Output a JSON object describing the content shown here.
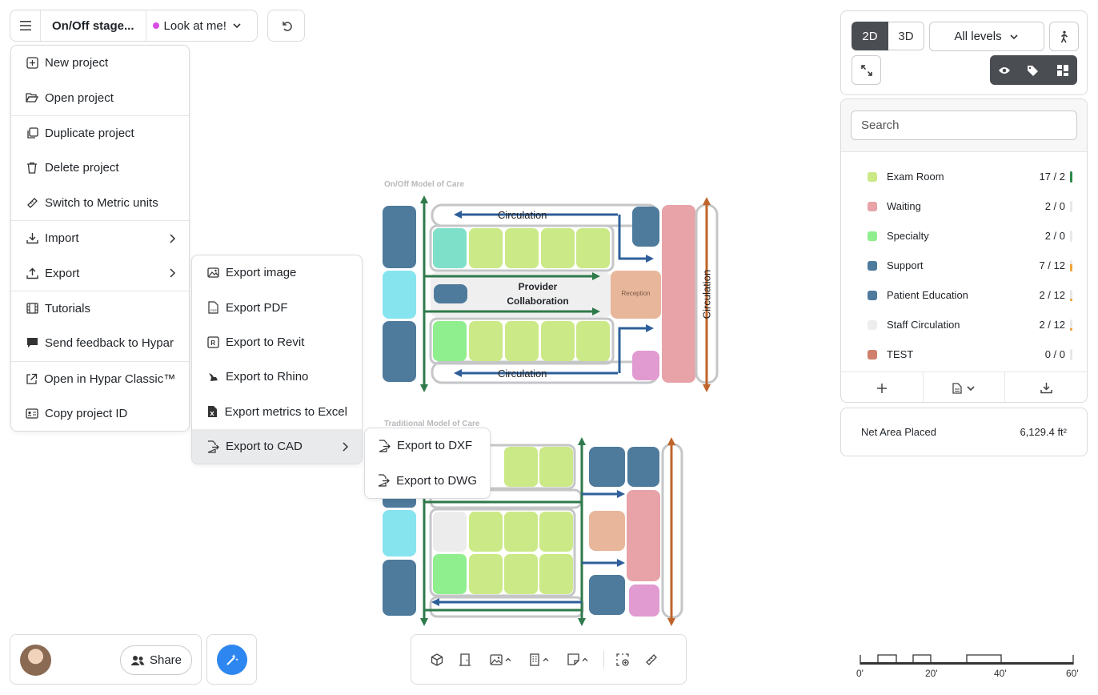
{
  "topbar": {
    "project_name": "On/Off stage...",
    "stage_label": "Look at me!"
  },
  "main_menu": {
    "items": [
      {
        "label": "New project",
        "icon": "new-project-icon"
      },
      {
        "label": "Open project",
        "icon": "folder-open-icon"
      },
      {
        "label": "Duplicate project",
        "icon": "duplicate-icon"
      },
      {
        "label": "Delete project",
        "icon": "trash-icon"
      },
      {
        "label": "Switch to Metric units",
        "icon": "ruler-icon"
      },
      {
        "label": "Import",
        "icon": "download-icon"
      },
      {
        "label": "Export",
        "icon": "upload-icon"
      },
      {
        "label": "Tutorials",
        "icon": "film-icon"
      },
      {
        "label": "Send feedback to Hypar",
        "icon": "comment-icon"
      },
      {
        "label": "Open in Hypar Classic™",
        "icon": "external-link-icon"
      },
      {
        "label": "Copy project ID",
        "icon": "id-card-icon"
      }
    ]
  },
  "export_menu": {
    "items": [
      {
        "label": "Export image"
      },
      {
        "label": "Export PDF"
      },
      {
        "label": "Export to Revit"
      },
      {
        "label": "Export to Rhino"
      },
      {
        "label": "Export metrics to Excel"
      },
      {
        "label": "Export to CAD"
      }
    ]
  },
  "cad_menu": {
    "items": [
      {
        "label": "Export to DXF"
      },
      {
        "label": "Export to DWG"
      }
    ]
  },
  "view": {
    "mode_2d": "2D",
    "mode_3d": "3D",
    "active_mode": "2D",
    "levels_label": "All levels"
  },
  "program": {
    "search_placeholder": "Search",
    "rows": [
      {
        "name": "Exam Room",
        "count": "17 / 2",
        "color": "#cbe987",
        "bar_color": "#2f8a4b",
        "fill": 1.0
      },
      {
        "name": "Waiting",
        "count": "2 / 0",
        "color": "#e7a3a8",
        "bar_color": "#e7e8ea",
        "fill": 0.0
      },
      {
        "name": "Specialty",
        "count": "2 / 0",
        "color": "#8fee8e",
        "bar_color": "#e7e8ea",
        "fill": 0.0
      },
      {
        "name": "Support",
        "count": "7 / 12",
        "color": "#4e7a9c",
        "bar_color": "#f0a43a",
        "fill": 0.58
      },
      {
        "name": "Patient Education",
        "count": "2 / 12",
        "color": "#4e7a9c",
        "bar_color": "#f0a43a",
        "fill": 0.17
      },
      {
        "name": "Staff Circulation",
        "count": "2 / 12",
        "color": "#ededed",
        "bar_color": "#f0a43a",
        "fill": 0.17
      },
      {
        "name": "TEST",
        "count": "0 / 0",
        "color": "#cf7f6b",
        "bar_color": "#e7e8ea",
        "fill": 0.0
      }
    ]
  },
  "area": {
    "label": "Net Area Placed",
    "value": "6,129.4 ft²"
  },
  "share": {
    "label": "Share"
  },
  "scale": {
    "labels": [
      "0'",
      "20'",
      "40'",
      "60'"
    ]
  },
  "canvas": {
    "plan1_title": "On/Off Model of Care",
    "plan2_title": "Traditional Model of Care",
    "circulation_label": "Circulation",
    "provider_label_line1": "Provider",
    "provider_label_line2": "Collaboration",
    "reception_label": "Reception"
  }
}
